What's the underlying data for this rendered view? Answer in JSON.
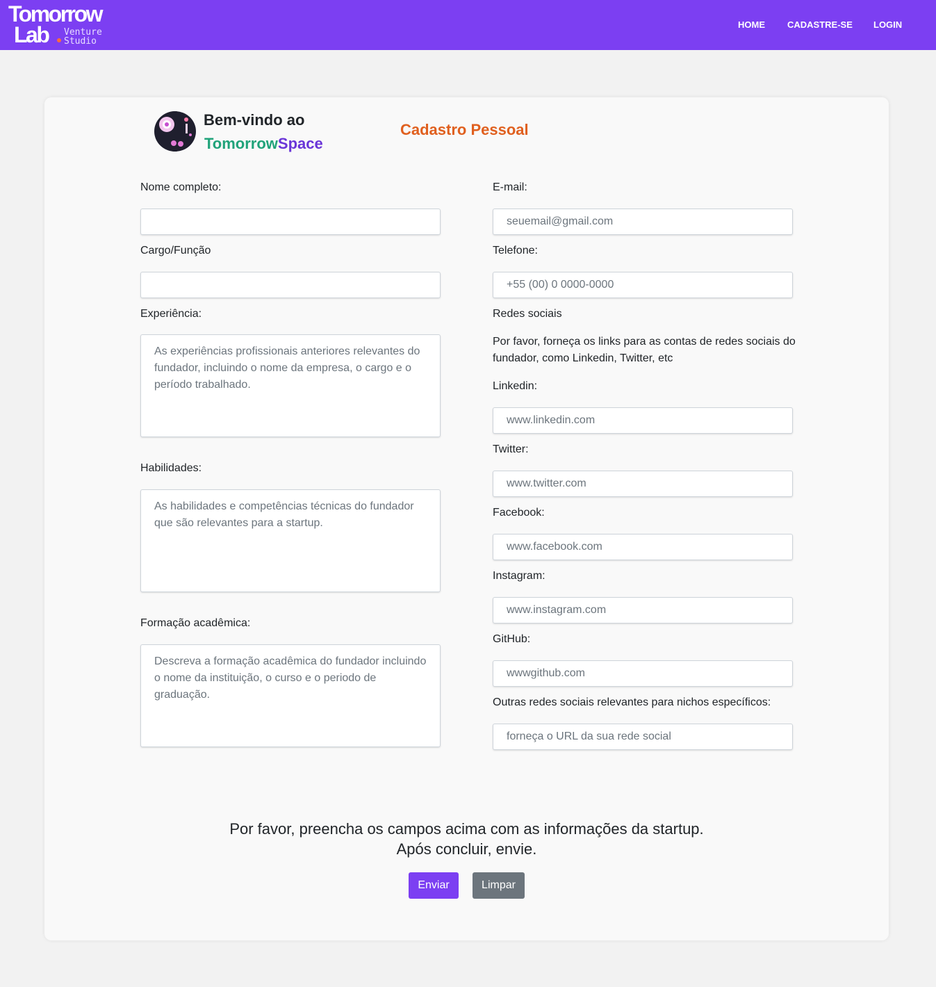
{
  "brand": {
    "line1": "Tomorrow",
    "line2": "Lab",
    "sub1": "Venture",
    "sub2": "Studio"
  },
  "nav": {
    "home": "HOME",
    "signup": "CADASTRE-SE",
    "login": "LOGIN"
  },
  "welcome": {
    "line1": "Bem-vindo ao",
    "name_part1": "Tomorrow",
    "name_part2": "Space"
  },
  "form_title": "Cadastro Pessoal",
  "left": {
    "name_label": "Nome completo:",
    "name_value": "",
    "role_label": "Cargo/Função",
    "role_value": "",
    "experience_label": "Experiência:",
    "experience_placeholder": "As experiências profissionais anteriores relevantes do fundador, incluindo o nome da empresa, o cargo e o período trabalhado.",
    "skills_label": "Habilidades:",
    "skills_placeholder": "As habilidades e competências técnicas do fundador que são relevantes para a startup.",
    "education_label": "Formação acadêmica:",
    "education_placeholder": "Descreva a formação acadêmica do fundador incluindo o nome da instituição, o curso e o periodo de graduação."
  },
  "right": {
    "email_label": "E-mail:",
    "email_placeholder": "seuemail@gmail.com",
    "phone_label": "Telefone:",
    "phone_placeholder": "+55 (00) 0 0000-0000",
    "social_label": "Redes sociais",
    "social_desc": "Por favor, forneça os links para as contas de redes sociais do fundador, como Linkedin, Twitter, etc",
    "linkedin_label": "Linkedin:",
    "linkedin_placeholder": "www.linkedin.com",
    "twitter_label": "Twitter:",
    "twitter_placeholder": "www.twitter.com",
    "facebook_label": "Facebook:",
    "facebook_placeholder": "www.facebook.com",
    "instagram_label": "Instagram:",
    "instagram_placeholder": "www.instagram.com",
    "github_label": "GitHub:",
    "github_placeholder": "wwwgithub.com",
    "other_label": "Outras redes sociais relevantes para nichos específicos:",
    "other_placeholder": "forneça o URL da sua rede social"
  },
  "footer": {
    "msg_line1": "Por favor, preencha os campos acima com as informações da startup.",
    "msg_line2": "Após concluir, envie.",
    "send_label": "Enviar",
    "clear_label": "Limpar"
  },
  "colors": {
    "brand_purple": "#7c3ff2",
    "title_orange": "#e0601f",
    "teal": "#20a37a",
    "space_purple": "#6a35d8",
    "clear_gray": "#6c757d"
  }
}
